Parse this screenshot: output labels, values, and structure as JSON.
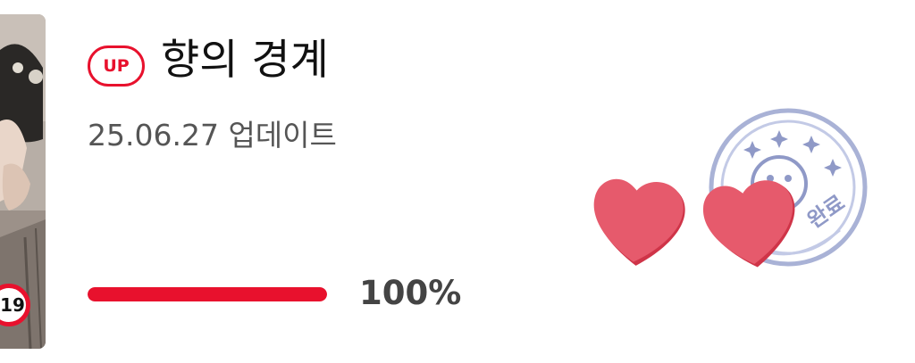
{
  "thumbnail": {
    "alt": "series cover art",
    "age_rating": "19"
  },
  "header": {
    "up_badge": "UP",
    "title": "향의 경계"
  },
  "meta": {
    "updated_text": "25.06.27 업데이트"
  },
  "progress": {
    "value": 1.0,
    "label": "100%"
  },
  "stamp": {
    "icon": "smiley-stamp-icon",
    "text": "완료"
  },
  "colors": {
    "accent": "#e8112d",
    "heart": "#e65a6c",
    "stamp": "#9aa6cf"
  }
}
